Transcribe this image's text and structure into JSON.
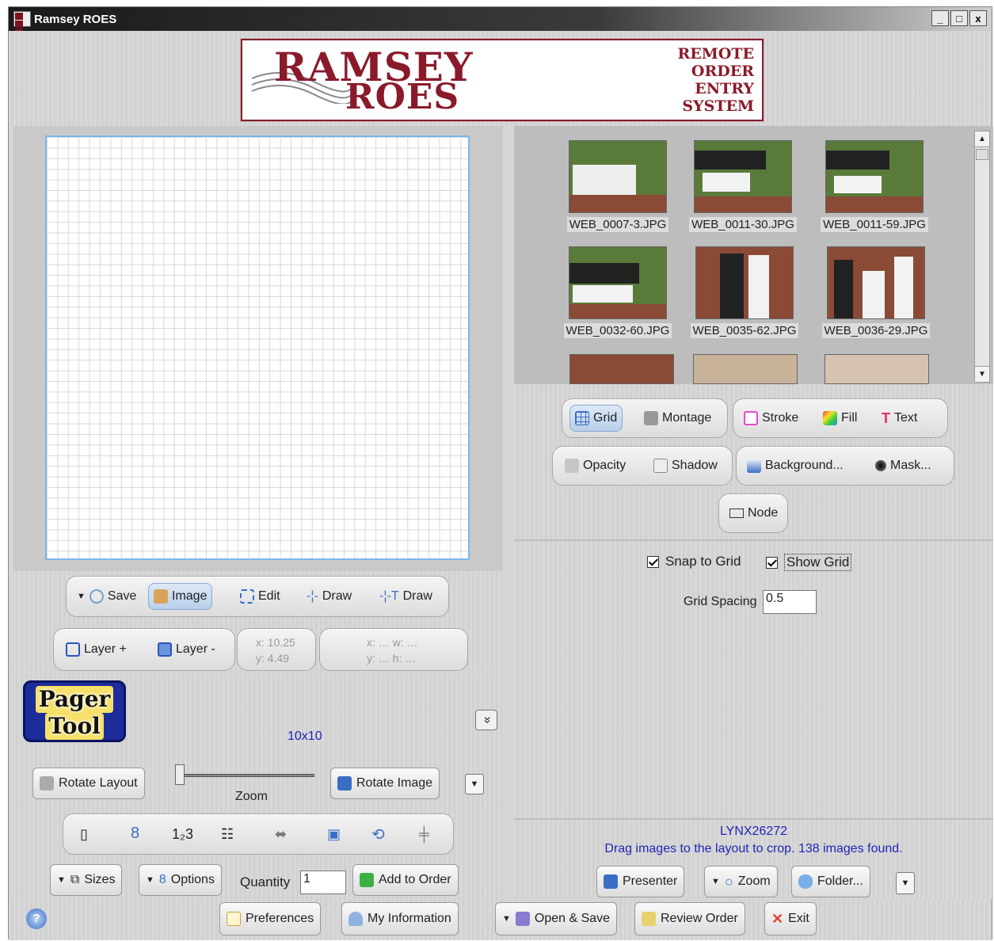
{
  "window": {
    "title": "Ramsey ROES",
    "minimize": "_",
    "maximize": "□",
    "close": "x"
  },
  "logo": {
    "line1": "RAMSEY",
    "line2": "ROES",
    "side": [
      "REMOTE",
      "ORDER",
      "ENTRY",
      "SYSTEM"
    ]
  },
  "canvas_toolbar": {
    "save": "Save",
    "image": "Image",
    "edit": "Edit",
    "draw": "Draw",
    "text_draw": "Draw",
    "layer_add": "Layer +",
    "layer_remove": "Layer -",
    "coords": {
      "x": "x: 10.25",
      "y": "y: 4.49"
    },
    "selection": {
      "x": "x: … w: …",
      "y": "y: … h: …"
    }
  },
  "pager": {
    "logo_line1": "Pager",
    "logo_line2": "Tool",
    "size_label": "10x10",
    "collapse": "»"
  },
  "layout_controls": {
    "rotate_layout": "Rotate Layout",
    "zoom": "Zoom",
    "rotate_image": "Rotate Image",
    "sizes": "Sizes",
    "options": "Options",
    "quantity_label": "Quantity",
    "quantity_value": "1",
    "add_to_order": "Add to Order"
  },
  "thumbnails": [
    {
      "name": "WEB_0007-3.JPG"
    },
    {
      "name": "WEB_0011-30.JPG"
    },
    {
      "name": "WEB_0011-59.JPG"
    },
    {
      "name": "WEB_0032-60.JPG"
    },
    {
      "name": "WEB_0035-62.JPG"
    },
    {
      "name": "WEB_0036-29.JPG"
    }
  ],
  "tools": {
    "grid": "Grid",
    "montage": "Montage",
    "stroke": "Stroke",
    "fill": "Fill",
    "text": "Text",
    "opacity": "Opacity",
    "shadow": "Shadow",
    "background": "Background...",
    "mask": "Mask...",
    "node": "Node"
  },
  "grid_options": {
    "snap": "Snap to Grid",
    "show": "Show Grid",
    "spacing_label": "Grid Spacing",
    "spacing_value": "0.5"
  },
  "status": {
    "code": "LYNX26272",
    "message": "Drag images to the layout to crop. 138 images found."
  },
  "browser_buttons": {
    "presenter": "Presenter",
    "zoom": "Zoom",
    "folder": "Folder..."
  },
  "bottom": {
    "help": "?",
    "preferences": "Preferences",
    "my_information": "My Information",
    "open_save": "Open & Save",
    "review_order": "Review Order",
    "exit": "Exit"
  },
  "colors": {
    "accent": "#8a1a2a",
    "blue_text": "#2323b8",
    "selection": "#b9cfe9"
  }
}
